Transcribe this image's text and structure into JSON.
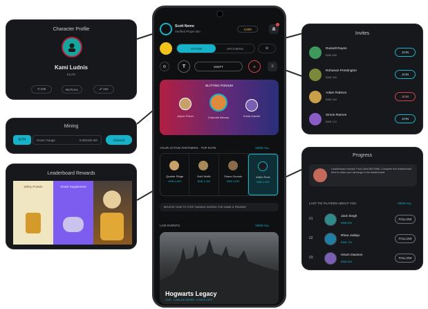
{
  "colors": {
    "accent": "#16b2c9",
    "danger": "#d83c4e",
    "panel": "#17181b",
    "phone_bg": "#0f1012"
  },
  "profile_card": {
    "title": "Character Profile",
    "name": "Kami Ludnis",
    "sub": "ELITE",
    "actions": [
      "⟲ 238",
      "MUTUAL",
      "☍ 162"
    ]
  },
  "mining_card": {
    "title": "Mining",
    "tag": "ETH",
    "field_value": "Hover Gauge",
    "field_rate": "0.000100 eth",
    "button": "Claimed"
  },
  "leaderboard_card": {
    "title": "Leaderboard Rewards",
    "tiles": [
      "Whey Protein",
      "Smart Supplement",
      ""
    ]
  },
  "phone": {
    "username": "Scott Nemo",
    "handle": "Verified Player Bio",
    "coins": "4,000",
    "tabs": [
      "ACTIVE",
      "UPCOMING"
    ],
    "pill_label": "SWIFT",
    "featured_title": "BLITTING PODIUM",
    "podium": [
      {
        "name": "Jayton Fisher",
        "score": "",
        "color": "#c8a06a"
      },
      {
        "name": "Charlotte Alfonso",
        "score": "",
        "color": "#e08a3c"
      },
      {
        "name": "Krista Gabriel",
        "score": "",
        "color": "#7a5fb4"
      }
    ],
    "section2_title": "YOUR ACTIVE PARTNERS · TOP RATE",
    "section2_link": "VIEW ALL",
    "partners": [
      {
        "name": "Quarter Ridge",
        "sub": "BNB 4,800"
      },
      {
        "name": "Gold Wolfe",
        "sub": "BNB 4,400"
      },
      {
        "name": "Shaun Zenoris",
        "sub": "BNB 3,000"
      },
      {
        "name": "Aiden Rock",
        "sub": "BNB 2,000"
      }
    ],
    "banner_text": "BELIEVE HOW TO STOP GAINING DURING THE GAME & TRADING",
    "section3_title": "LIVE EVENTS",
    "section3_link": "VIEW ALL",
    "event_title": "Hogwarts Legacy",
    "event_sub": "LIVE · 1,300,240 VIEWS · 4 DAYS LEFT"
  },
  "invites_card": {
    "title": "Invites",
    "rows": [
      {
        "name": "Russell Rayes",
        "sub": "BNB 480",
        "action": "JOIN",
        "color": "#3d9a5c",
        "kind": "ok"
      },
      {
        "name": "Rohanan Prestington",
        "sub": "BNB 240",
        "action": "JOIN",
        "color": "#7b8a3a",
        "kind": "ok"
      },
      {
        "name": "Adam Rabson",
        "sub": "BNB 160",
        "action": "JOIN",
        "color": "#c9a04a",
        "kind": "no"
      },
      {
        "name": "Simon Ramos",
        "sub": "BNB 120",
        "action": "JOIN",
        "color": "#8a5cc8",
        "kind": "ok"
      }
    ]
  },
  "progress_card": {
    "title": "Progress",
    "note": "Leaderboard reward: Pool Used 800 BNB. Complete the leaderboard tiers to claim your winnings in the leaderboard.",
    "list_title": "LAST TIE PLAYERS ABOUT YOU",
    "list_link": "VIEW ALL",
    "rows": [
      {
        "rank": "01",
        "name": "Jack Singh",
        "sub": "BNB 800",
        "action": "FOLLOW"
      },
      {
        "rank": "02",
        "name": "Rhea Jadeja",
        "sub": "BNB 700",
        "action": "FOLLOW"
      },
      {
        "rank": "03",
        "name": "Hiram Dawson",
        "sub": "BNB 600",
        "action": "FOLLOW"
      }
    ]
  }
}
